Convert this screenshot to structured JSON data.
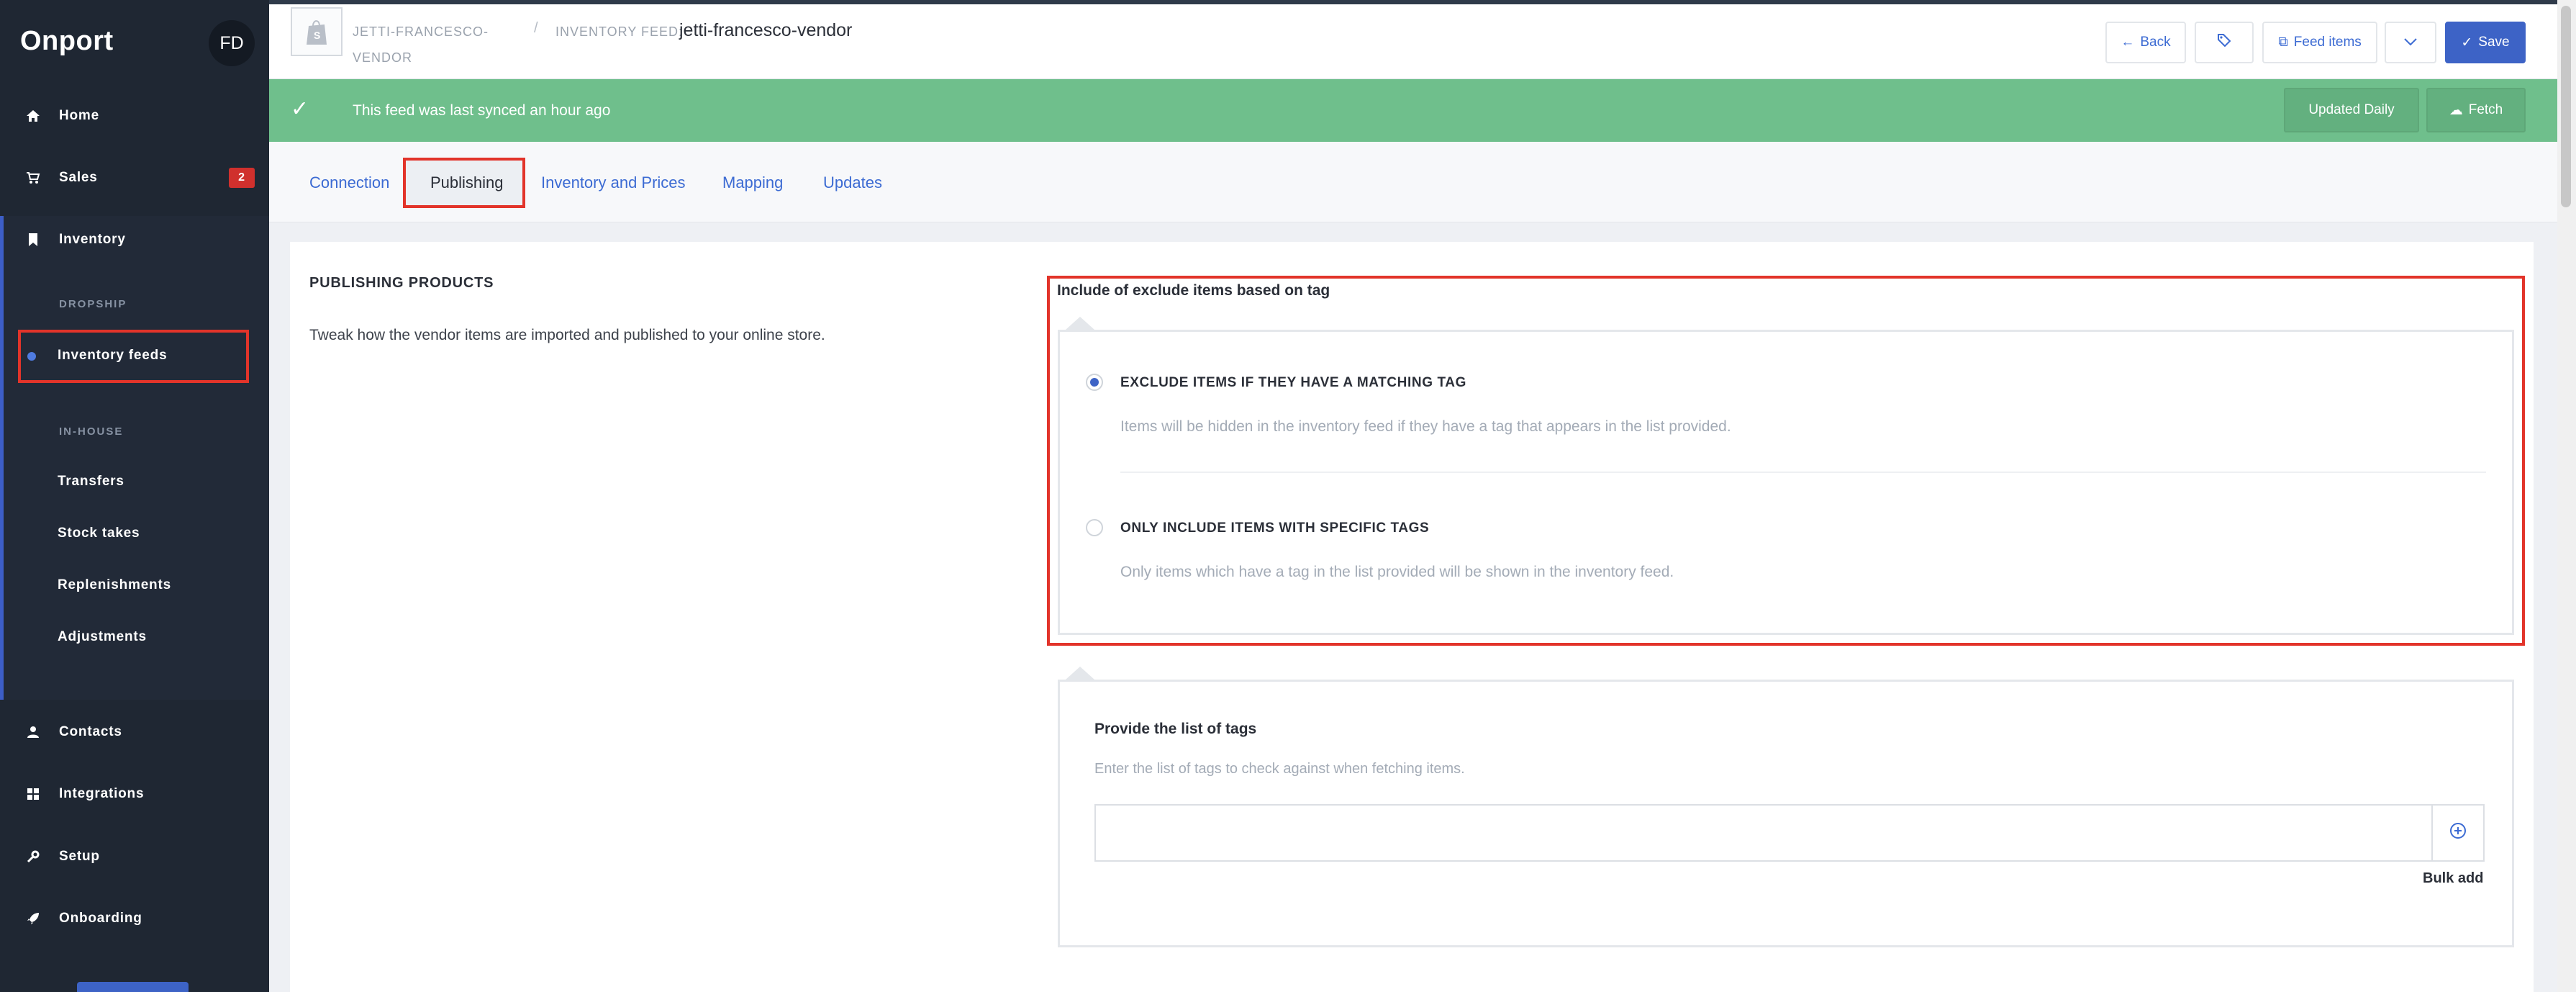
{
  "app": {
    "brand": "Onport",
    "user_initials": "FD"
  },
  "sidebar": {
    "home": "Home",
    "sales": "Sales",
    "sales_badge": "2",
    "inventory": "Inventory",
    "dropship_heading": "DROPSHIP",
    "inventory_feeds": "Inventory feeds",
    "inhouse_heading": "IN-HOUSE",
    "transfers": "Transfers",
    "stock_takes": "Stock takes",
    "replenishments": "Replenishments",
    "adjustments": "Adjustments",
    "contacts": "Contacts",
    "integrations": "Integrations",
    "setup": "Setup",
    "onboarding": "Onboarding"
  },
  "header": {
    "vendor_crumb": "JETTI-FRANCESCO-VENDOR",
    "separator": "/",
    "feed_label": "INVENTORY FEED:",
    "feed_title": "jetti-francesco-vendor",
    "back_label": "Back",
    "feed_items_label": "Feed items",
    "save_label": "Save"
  },
  "alert": {
    "message": "This feed was last synced an hour ago",
    "schedule_label": "Updated Daily",
    "fetch_label": "Fetch"
  },
  "tabs": [
    "Connection",
    "Publishing",
    "Inventory and Prices",
    "Mapping",
    "Updates"
  ],
  "publishing": {
    "title": "PUBLISHING PRODUCTS",
    "description": "Tweak how the vendor items are imported and published to your online store.",
    "group_label": "Include of exclude items based on tag",
    "options": [
      {
        "title": "EXCLUDE ITEMS IF THEY HAVE A MATCHING TAG",
        "description": "Items will be hidden in the inventory feed if they have a tag that appears in the list provided.",
        "selected": true
      },
      {
        "title": "ONLY INCLUDE ITEMS WITH SPECIFIC TAGS",
        "description": "Only items which have a tag in the list provided will be shown in the inventory feed.",
        "selected": false
      }
    ],
    "tags": {
      "title": "Provide the list of tags",
      "description": "Enter the list of tags to check against when fetching items.",
      "input_value": "",
      "bulk_add_label": "Bulk add"
    }
  },
  "colors": {
    "sidebar_bg": "#1f2733",
    "accent": "#3d63c6",
    "success": "#6fbf8c",
    "highlight": "#e2342a",
    "badge": "#d0302d"
  }
}
